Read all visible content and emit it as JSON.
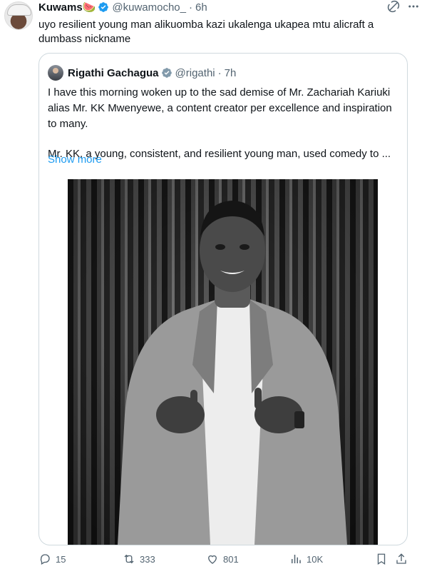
{
  "tweet": {
    "author_name": "Kuwams",
    "author_emoji": "🍉",
    "handle": "@kuwamocho_",
    "time_separator": "·",
    "time": "6h",
    "text": "uyo resilient young man alikuomba kazi ukalenga ukapea mtu alicraft a dumbass nickname"
  },
  "quote": {
    "author_name": "Rigathi Gachagua",
    "handle": "@rigathi",
    "time_separator": "·",
    "time": "7h",
    "paragraph_1": "I have this morning woken up to the sad demise of Mr. Zachariah Kariuki alias Mr. KK Mwenyewe, a content creator per excellence and inspiration to many.",
    "paragraph_2": "Mr. KK, a young, consistent, and resilient young man, used comedy to ...",
    "show_more": "Show more"
  },
  "actions": {
    "replies": "15",
    "retweets": "333",
    "likes": "801",
    "views": "10K"
  },
  "colors": {
    "verified": "#1d9bf0",
    "link": "#1d9bf0",
    "muted": "#536471"
  }
}
